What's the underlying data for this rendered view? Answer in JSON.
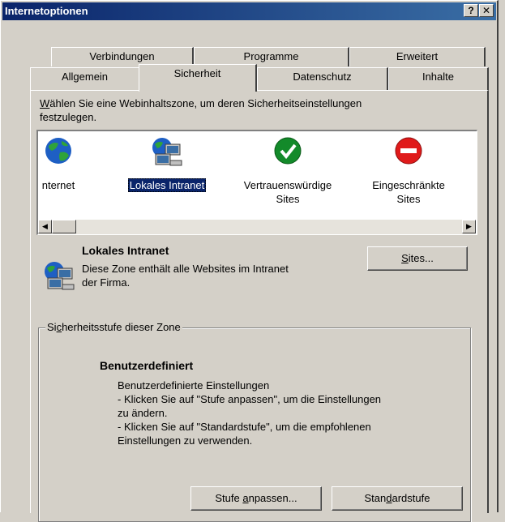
{
  "window": {
    "title": "Internetoptionen",
    "help_btn": "?",
    "close_btn": "✕"
  },
  "tabs_back": [
    "Verbindungen",
    "Programme",
    "Erweitert"
  ],
  "tabs_front": [
    "Allgemein",
    "Sicherheit",
    "Datenschutz",
    "Inhalte"
  ],
  "active_tab": "Sicherheit",
  "instructions": {
    "line1_prefix": "W",
    "line1_rest": "ählen Sie eine Webinhaltszone, um deren Sicherheitseinstellungen",
    "line2": "festzulegen."
  },
  "zones": [
    {
      "label_l1": "nternet",
      "label_l2": "",
      "icon": "globe-icon"
    },
    {
      "label_l1": "Lokales Intranet",
      "label_l2": "",
      "icon": "intranet-computers-icon"
    },
    {
      "label_l1": "Vertrauenswürdige",
      "label_l2": "Sites",
      "icon": "checkmark-icon"
    },
    {
      "label_l1": "Eingeschränkte",
      "label_l2": "Sites",
      "icon": "no-entry-icon"
    }
  ],
  "selected_zone": {
    "title": "Lokales Intranet",
    "desc_l1": "Diese Zone enthält alle Websites im Intranet",
    "desc_l2": "der Firma.",
    "sites_button_prefix": "S",
    "sites_button_rest": "ites..."
  },
  "security_level": {
    "legend_pre": "Si",
    "legend_u": "c",
    "legend_post": "herheitsstufe dieser Zone",
    "title": "Benutzerdefiniert",
    "lines": [
      "Benutzerdefinierte Einstellungen",
      "- Klicken Sie auf \"Stufe anpassen\", um die Einstellungen",
      "zu ändern.",
      "- Klicken Sie auf \"Standardstufe\", um die empfohlenen",
      "Einstellungen zu verwenden."
    ],
    "custom_btn_pre": "Stufe ",
    "custom_btn_u": "a",
    "custom_btn_post": "npassen...",
    "default_btn_pre": "Stan",
    "default_btn_u": "d",
    "default_btn_post": "ardstufe"
  },
  "colors": {
    "titlebar_start": "#0a246a",
    "titlebar_end": "#3a6ea5",
    "face": "#d4d0c8",
    "selection": "#0a246a"
  }
}
